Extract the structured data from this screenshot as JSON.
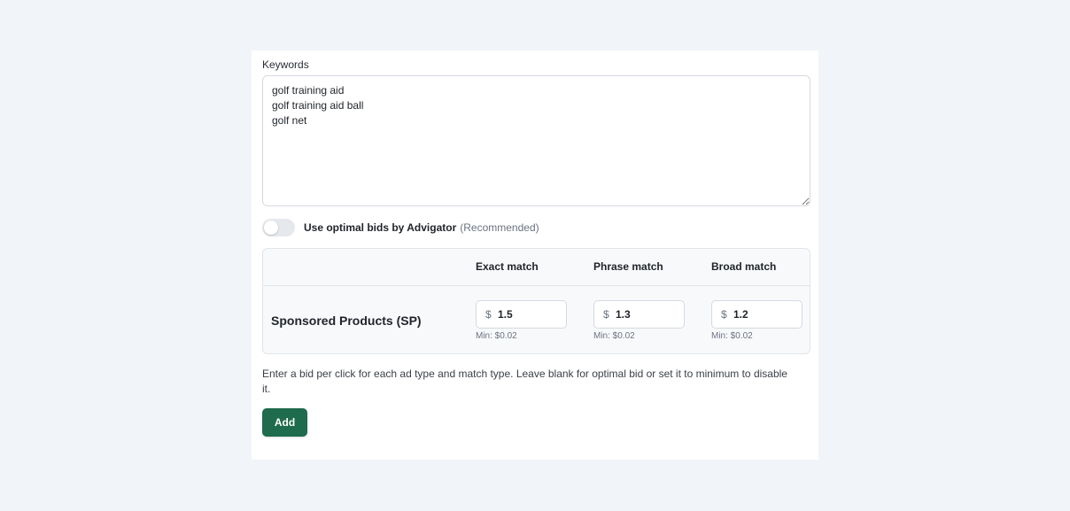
{
  "keywords": {
    "label": "Keywords",
    "value": "golf training aid\ngolf training aid ball\ngolf net"
  },
  "optimal_bids": {
    "label": "Use optimal bids by Advigator",
    "recommended": "(Recommended)",
    "enabled": false
  },
  "bid_table": {
    "columns": [
      "Exact match",
      "Phrase match",
      "Broad match"
    ],
    "rows": [
      {
        "label": "Sponsored Products (SP)",
        "currency": "$",
        "bids": [
          {
            "value": "1.5",
            "min": "Min: $0.02"
          },
          {
            "value": "1.3",
            "min": "Min: $0.02"
          },
          {
            "value": "1.2",
            "min": "Min: $0.02"
          }
        ]
      }
    ]
  },
  "help_text": "Enter a bid per click for each ad type and match type. Leave blank for optimal bid or set it to minimum to disable it.",
  "add_button": {
    "label": "Add"
  },
  "colors": {
    "background": "#f1f4f8",
    "primary_button": "#1f6b4d"
  }
}
